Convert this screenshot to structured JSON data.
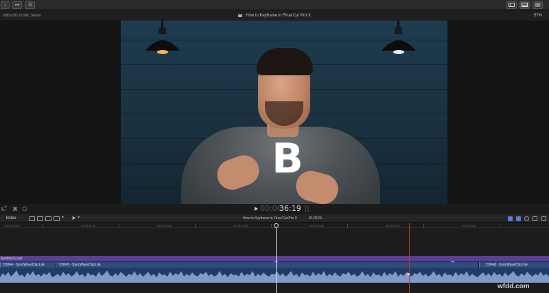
{
  "toolbar": {
    "buttons": [
      {
        "name": "import-icon",
        "glyph": "↓"
      },
      {
        "name": "keyword-icon",
        "glyph": "⊶"
      },
      {
        "name": "background-tasks-icon",
        "glyph": "⊙"
      }
    ],
    "right_buttons": [
      {
        "name": "libraries-layout-icon"
      },
      {
        "name": "timeline-layout-icon"
      },
      {
        "name": "inspector-layout-icon"
      }
    ]
  },
  "viewer": {
    "format": "1080p HD 23.98p, Stereo",
    "title": "How to Keyframe in Final Cut Pro X",
    "zoom": "57%",
    "overlay_letter": "B"
  },
  "playback": {
    "timecode_dim": "00:00",
    "timecode": "36:19"
  },
  "timeline": {
    "index_label": "Index",
    "project_title": "How to Keyframe in Final Cut Pro X",
    "duration": "01:03:01",
    "ruler_ticks": [
      "00:00:10:00",
      "00:00:15:00",
      "00:00:20:00",
      "00:00:25:00",
      "00:00:30:00",
      "00:00:35:00",
      "00:00:40:00",
      "00:00:45:00"
    ],
    "title_clip": "Bumbert Look",
    "clips": [
      "C0044 - SyncWaveClip Lite",
      "C0045 - SyncWaveClip Lite",
      "C0048 - SyncWaveClip Lite"
    ]
  },
  "watermark": "wfdd.com"
}
